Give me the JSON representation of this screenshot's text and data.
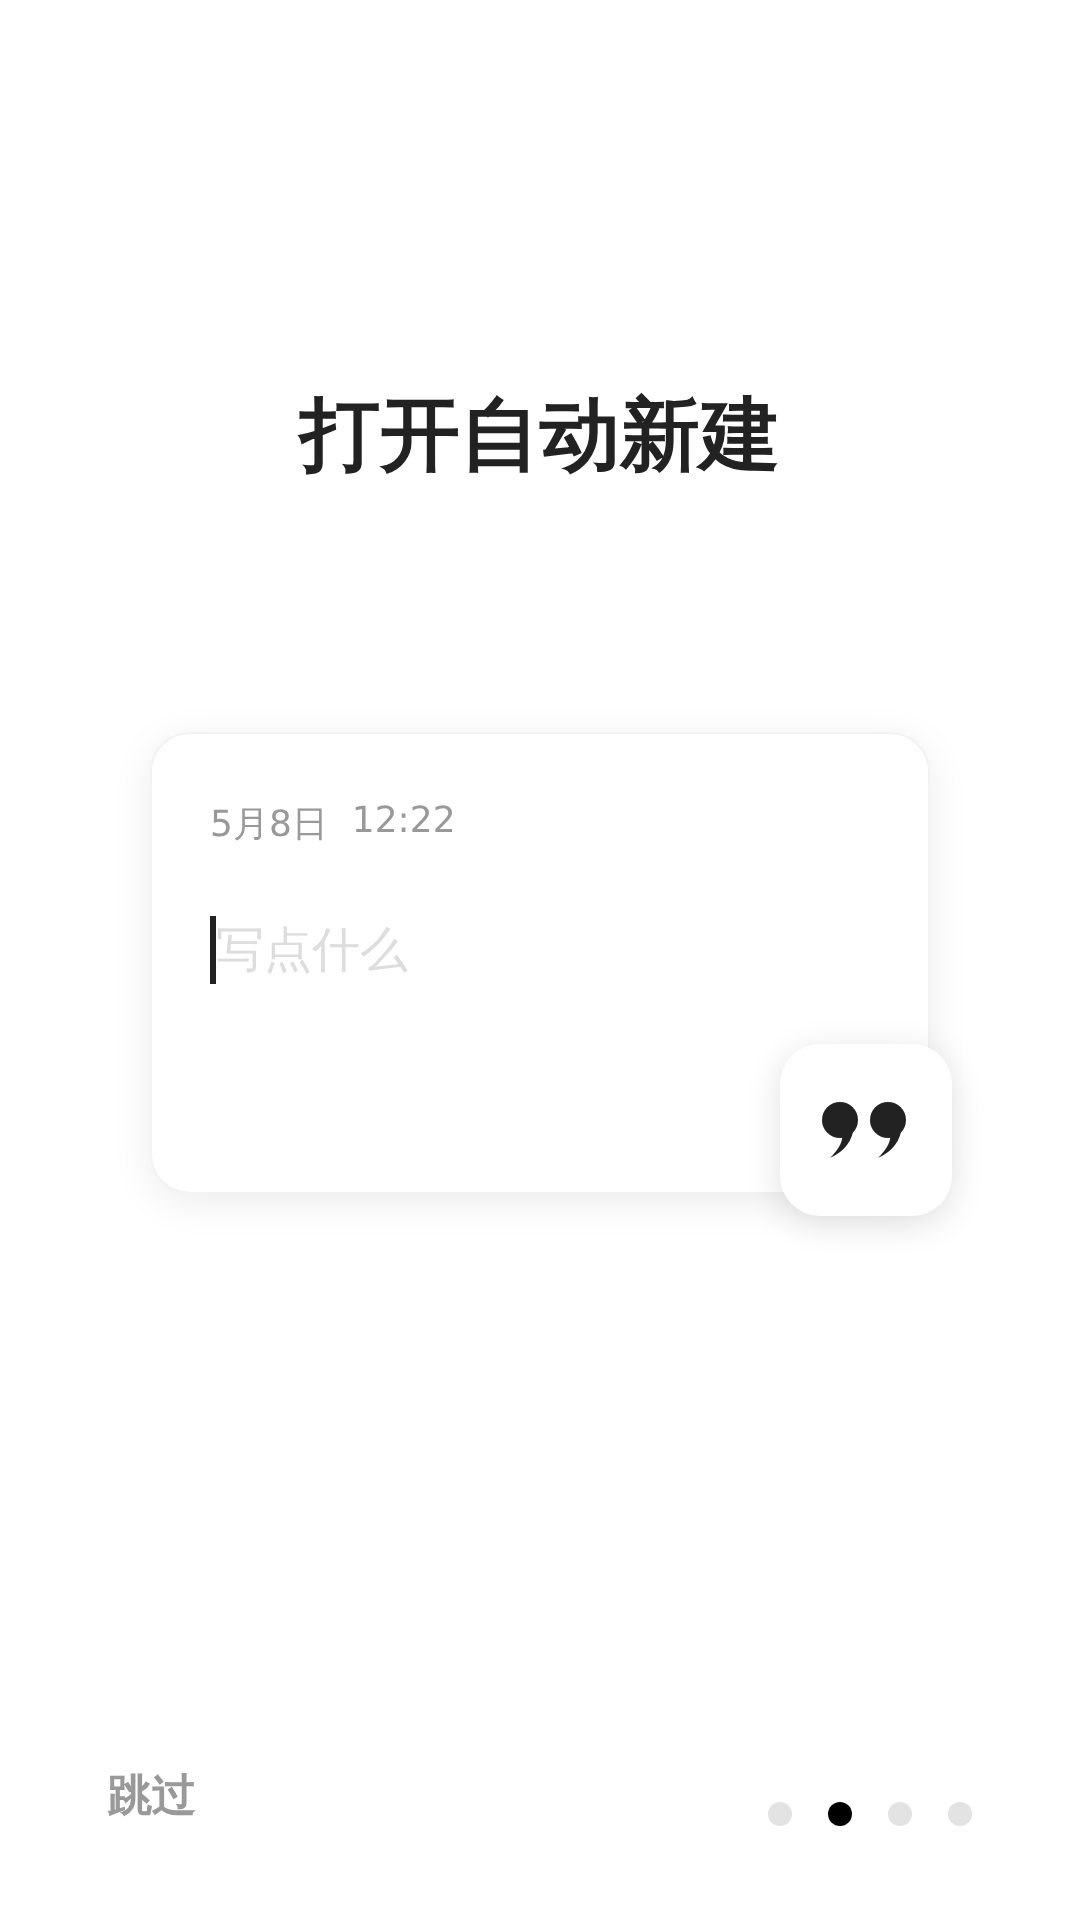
{
  "title": "打开自动新建",
  "note_card": {
    "date": "5月8日",
    "time": "12:22",
    "placeholder": "写点什么"
  },
  "skip_button": "跳过",
  "pager": [
    {
      "selected": false
    },
    {
      "selected": true
    },
    {
      "selected": false
    },
    {
      "selected": false
    }
  ]
}
